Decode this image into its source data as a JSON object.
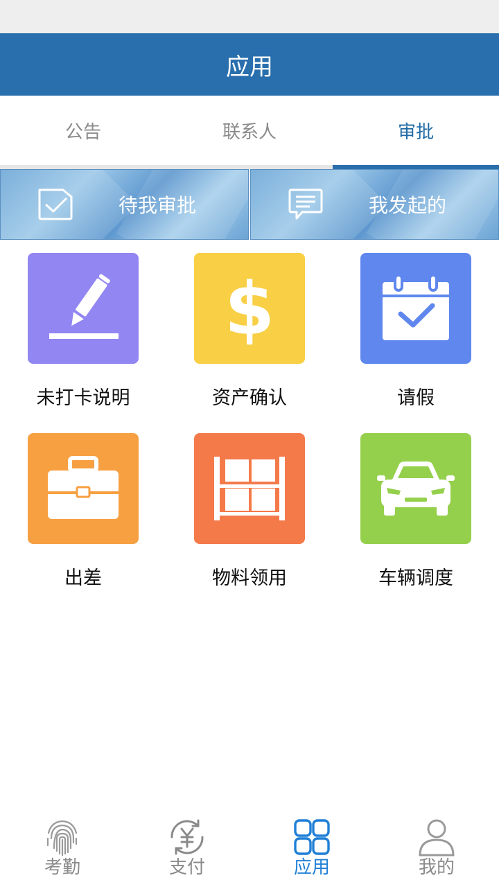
{
  "header": {
    "title": "应用"
  },
  "tabs": [
    {
      "label": "公告",
      "active": false
    },
    {
      "label": "联系人",
      "active": false
    },
    {
      "label": "审批",
      "active": true
    }
  ],
  "banners": [
    {
      "label": "待我审批",
      "icon": "check-box-icon"
    },
    {
      "label": "我发起的",
      "icon": "chat-bubble-icon"
    }
  ],
  "apps": [
    {
      "label": "未打卡说明",
      "icon": "pencil-icon",
      "color": "#9286f2"
    },
    {
      "label": "资产确认",
      "icon": "dollar-icon",
      "color": "#f8cf45"
    },
    {
      "label": "请假",
      "icon": "calendar-check-icon",
      "color": "#5f87ee"
    },
    {
      "label": "出差",
      "icon": "briefcase-icon",
      "color": "#f6a042"
    },
    {
      "label": "物料领用",
      "icon": "shelf-icon",
      "color": "#f47a4a"
    },
    {
      "label": "车辆调度",
      "icon": "car-icon",
      "color": "#95d04d"
    }
  ],
  "bottom_nav": [
    {
      "label": "考勤",
      "icon": "fingerprint-icon",
      "active": false
    },
    {
      "label": "支付",
      "icon": "yen-exchange-icon",
      "active": false
    },
    {
      "label": "应用",
      "icon": "apps-grid-icon",
      "active": true
    },
    {
      "label": "我的",
      "icon": "user-icon",
      "active": false
    }
  ],
  "colors": {
    "header": "#2a6fad",
    "active_tab": "#1f6aa5",
    "active_nav": "#1f7fd6",
    "inactive": "#8a8a8a"
  }
}
